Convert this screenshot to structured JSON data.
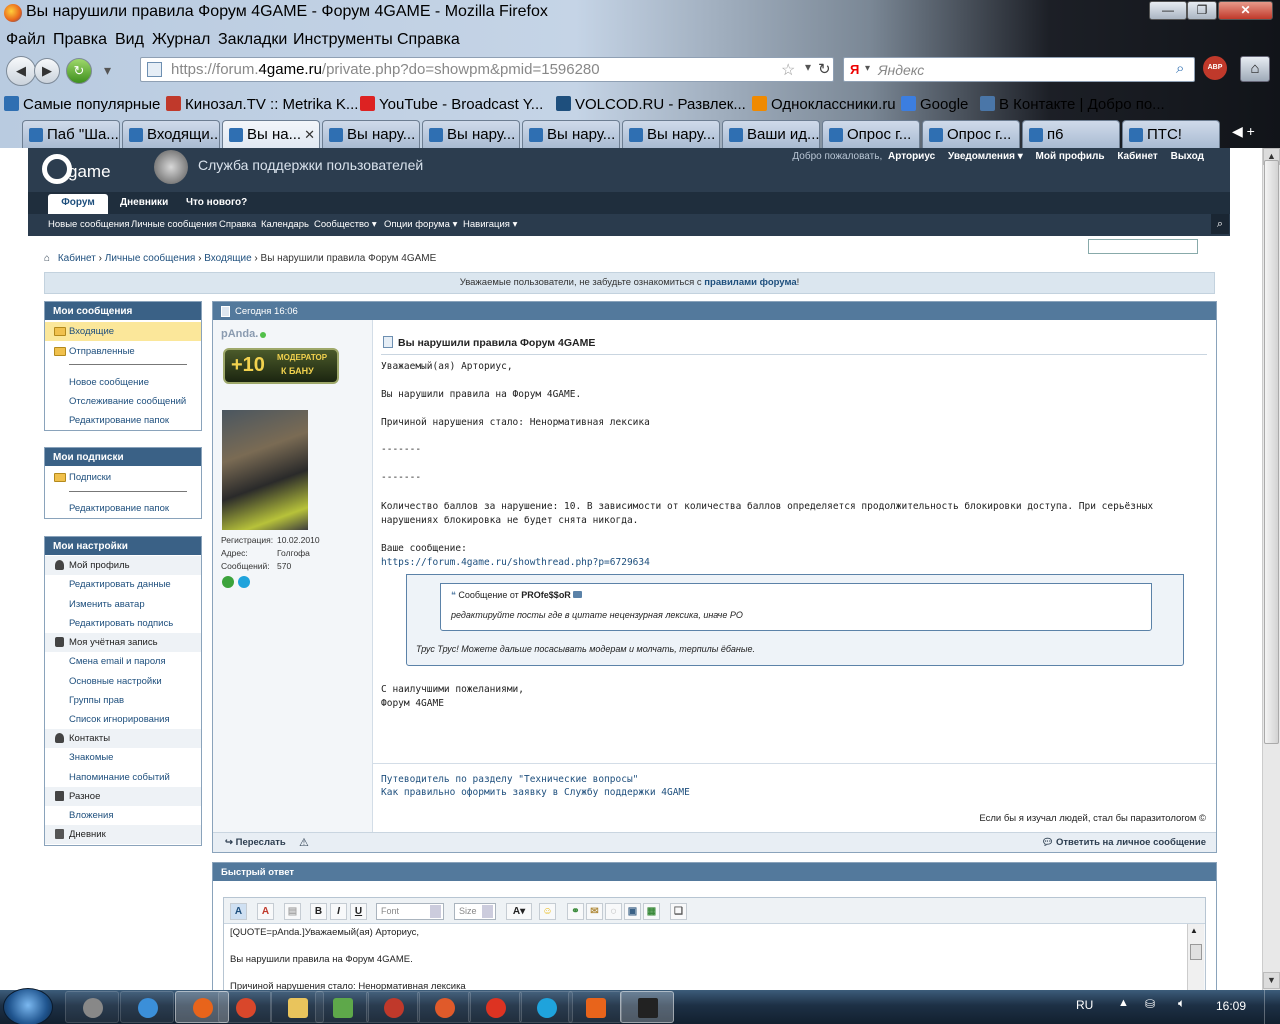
{
  "window": {
    "title": "Вы нарушили правила Форум 4GAME - Форум 4GAME - Mozilla Firefox",
    "menu": [
      "Файл",
      "Правка",
      "Вид",
      "Журнал",
      "Закладки",
      "Инструменты",
      "Справка"
    ],
    "url_prefix": "https://forum.",
    "url_host": "4game.ru",
    "url_path": "/private.php?do=showpm&pmid=1596280",
    "search_placeholder": "Яндекс",
    "bookmarks": [
      {
        "label": "Самые популярные",
        "color": "#2f6fb2"
      },
      {
        "label": "Кинозал.TV :: Metrika K...",
        "color": "#c0392b"
      },
      {
        "label": "YouTube - Broadcast Y...",
        "color": "#d22"
      },
      {
        "label": "VOLCOD.RU - Развлек...",
        "color": "#1e4f7d"
      },
      {
        "label": "Одноклассники.ru",
        "color": "#f08a00"
      },
      {
        "label": "Google",
        "color": "#3c7ee0"
      },
      {
        "label": "В Контакте | Добро по...",
        "color": "#4a76a8"
      }
    ],
    "tabs": [
      "Паб \"Ша...",
      "Входящи...",
      "Вы на...",
      "Вы нару...",
      "Вы нару...",
      "Вы нару...",
      "Вы нару...",
      "Ваши ид...",
      "Опрос г...",
      "Опрос г...",
      "п6",
      "ПТС!"
    ]
  },
  "header": {
    "logo_text": "game",
    "site_title": "Служба поддержки пользователей",
    "welcome": "Добро пожаловать,",
    "username": "Арториус",
    "notifications": "Уведомления ▾",
    "my_profile": "Мой профиль",
    "cabinet": "Кабинет",
    "logout": "Выход",
    "tabs": [
      "Форум",
      "Дневники",
      "Что нового?"
    ],
    "subnav": [
      "Новые сообщения",
      "Личные сообщения",
      "Справка",
      "Календарь",
      "Сообщество ▾",
      "Опции форума ▾",
      "Навигация ▾"
    ]
  },
  "breadcrumb": [
    "Кабинет",
    "Личные сообщения",
    "Входящие",
    "Вы нарушили правила Форум 4GAME"
  ],
  "notice": {
    "text": "Уважаемые пользователи, не забудьте ознакомиться с ",
    "link": "правилами форума",
    "end": "!"
  },
  "sidebar": {
    "messages": {
      "title": "Мои сообщения",
      "inbox": "Входящие",
      "sent": "Отправленные",
      "new": "Новое сообщение",
      "tracking": "Отслеживание сообщений",
      "folders": "Редактирование папок"
    },
    "subscriptions": {
      "title": "Мои подписки",
      "subs": "Подписки",
      "folders": "Редактирование папок"
    },
    "settings": {
      "title": "Мои настройки",
      "profile": "Мой профиль",
      "edit_data": "Редактировать данные",
      "avatar": "Изменить аватар",
      "signature": "Редактировать подпись",
      "account": "Моя учётная запись",
      "email_pwd": "Смена email и пароля",
      "general": "Основные настройки",
      "rights": "Группы прав",
      "ignore": "Список игнорирования",
      "contacts": "Контакты",
      "friends": "Знакомые",
      "reminders": "Напоминание событий",
      "misc": "Разное",
      "attachments": "Вложения",
      "diary": "Дневник"
    }
  },
  "post": {
    "date": "Сегодня 16:06",
    "author": "pAnda.",
    "rank_big": "+10",
    "rank_line1": "МОДЕРАТОР",
    "rank_line2": "К БАНУ",
    "reg_label": "Регистрация:",
    "reg_value": "10.02.2010",
    "addr_label": "Адрес:",
    "addr_value": "Голгофа",
    "posts_label": "Сообщений:",
    "posts_value": "570",
    "title": "Вы нарушили правила Форум 4GAME",
    "lines": [
      "Уважаемый(ая) Арториус,",
      "Вы нарушили правила на Форум 4GAME.",
      "Причиной нарушения стало: Ненормативная лексика",
      "-------",
      "-------",
      "Количество баллов за нарушение: 10. В зависимости от количества баллов определяется продолжительность блокировки доступа. При серьёзных",
      "нарушениях блокировка не будет снята никогда.",
      "Ваше сообщение:"
    ],
    "link": "https://forum.4game.ru/showthread.php?p=6729634",
    "quote_author_prefix": "Сообщение от",
    "quote_author": "PROfe$$oR",
    "inner_quote_text": "редактируйте посты где в цитате нецензурная лексика, иначе РО",
    "outer_quote_text": "Трус Трус! Можете дальше посасывать модерам и молчать, терпилы ёбаные.",
    "closing1": "С наилучшими пожеланиями,",
    "closing2": "Форум 4GAME",
    "sig_link1": "Путеводитель по разделу \"Технические вопросы\"",
    "sig_link2": "Как правильно оформить заявку в Службу поддержки 4GAME",
    "sig_quote": "Если бы я изучал людей, стал бы паразитологом ©",
    "forward": "Переслать",
    "reply": "Ответить на личное сообщение"
  },
  "quick_reply": {
    "title": "Быстрый ответ",
    "font": "Font",
    "size": "Size",
    "editor_lines": [
      "[QUOTE=pAnda.]Уважаемый(ая) Арториус,",
      "Вы нарушили правила на Форум 4GAME.",
      "Причиной нарушения стало: Ненормативная лексика"
    ]
  },
  "taskbar": {
    "lang": "RU",
    "time": "16:09"
  }
}
